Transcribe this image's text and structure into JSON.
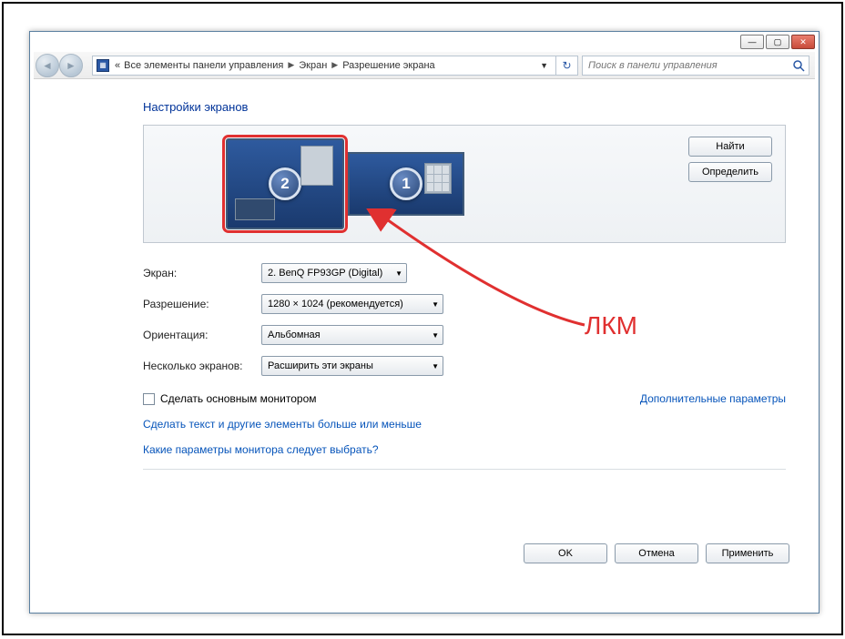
{
  "breadcrumb": {
    "prefix": "«",
    "seg1": "Все элементы панели управления",
    "seg2": "Экран",
    "seg3": "Разрешение экрана"
  },
  "search": {
    "placeholder": "Поиск в панели управления"
  },
  "page_title": "Настройки экранов",
  "monitors": {
    "m1": "1",
    "m2": "2"
  },
  "buttons": {
    "find": "Найти",
    "identify": "Определить",
    "ok": "OK",
    "cancel": "Отмена",
    "apply": "Применить"
  },
  "labels": {
    "screen": "Экран:",
    "resolution": "Разрешение:",
    "orientation": "Ориентация:",
    "multiple": "Несколько экранов:",
    "make_primary": "Сделать основным монитором",
    "advanced": "Дополнительные параметры"
  },
  "dropdowns": {
    "screen": "2. BenQ FP93GP (Digital)",
    "resolution": "1280 × 1024 (рекомендуется)",
    "orientation": "Альбомная",
    "multiple": "Расширить эти экраны"
  },
  "links": {
    "text_size": "Сделать текст и другие элементы больше или меньше",
    "which_params": "Какие параметры монитора следует выбрать?"
  },
  "annotation": "ЛКМ"
}
